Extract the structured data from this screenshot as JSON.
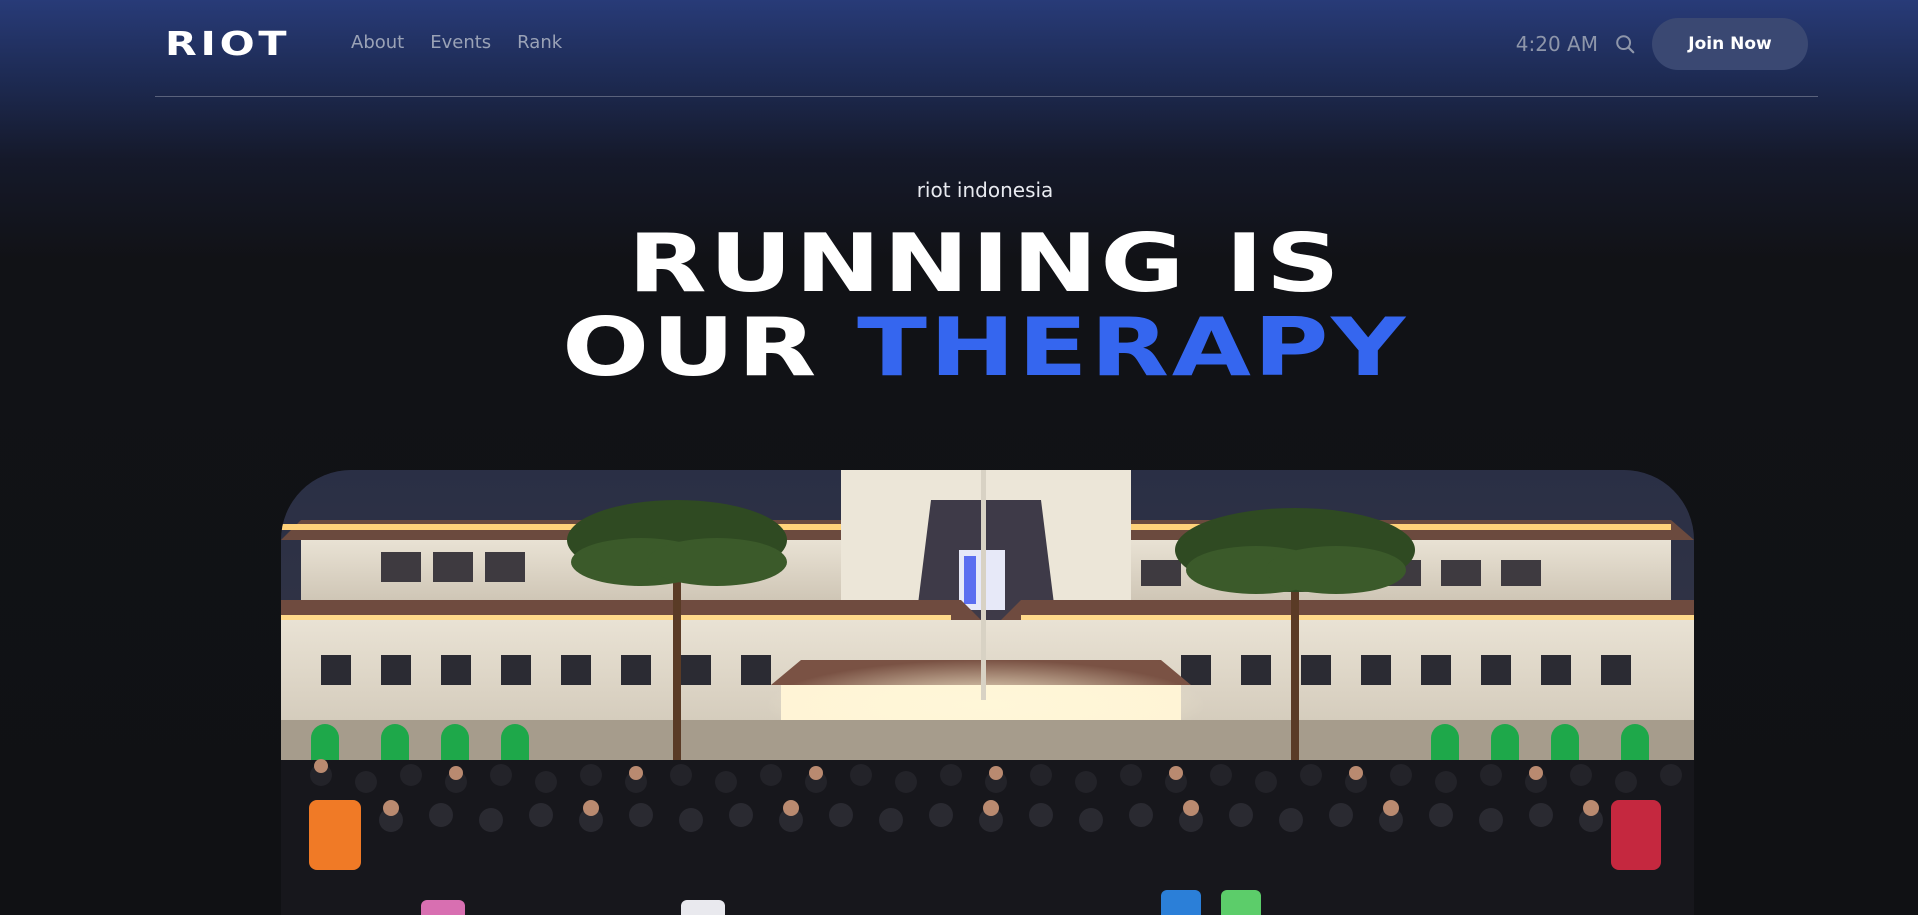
{
  "nav": {
    "logo": "RIOT",
    "links": [
      "About",
      "Events",
      "Rank"
    ],
    "time": "4:20 AM",
    "join_label": "Join Now"
  },
  "hero": {
    "eyebrow": "riot indonesia",
    "line1": "RUNNING IS",
    "line2_prefix": "OUR",
    "line2_accent": "THERAPY"
  },
  "colors": {
    "accent": "#3566ef",
    "nav_bg_top": "#283b78",
    "page_bg": "#101114",
    "button_bg": "#3a4872"
  },
  "icons": {
    "search": "search-icon"
  },
  "image": {
    "subject": "group-photo"
  }
}
